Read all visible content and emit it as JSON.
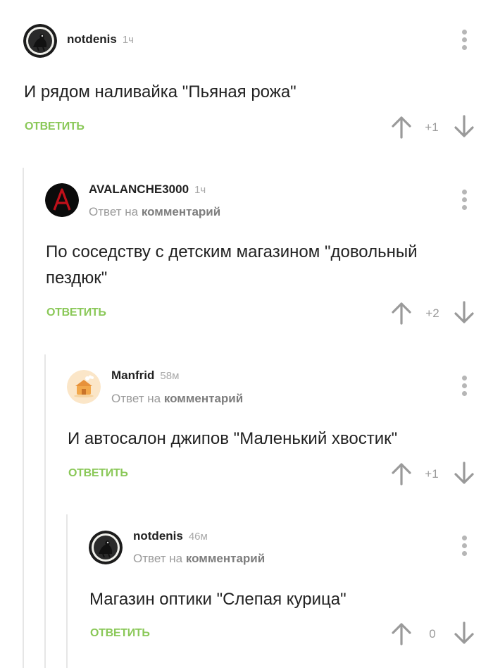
{
  "thread": {
    "comments": [
      {
        "username": "notdenis",
        "time": "1ч",
        "text": "И рядом наливайка \"Пьяная рожа\"",
        "reply_label": "ОТВЕТИТЬ",
        "rating": "+1"
      },
      {
        "username": "AVALANCHE3000",
        "time": "1ч",
        "reply_prefix": "Ответ на",
        "reply_target": "комментарий",
        "text": "По соседству с детским магазином \"довольный пездюк\"",
        "reply_label": "ОТВЕТИТЬ",
        "rating": "+2"
      },
      {
        "username": "Manfrid",
        "time": "58м",
        "reply_prefix": "Ответ на",
        "reply_target": "комментарий",
        "text": "И автосалон джипов \"Маленький хвостик\"",
        "reply_label": "ОТВЕТИТЬ",
        "rating": "+1"
      },
      {
        "username": "notdenis",
        "time": "46м",
        "reply_prefix": "Ответ на",
        "reply_target": "комментарий",
        "text": "Магазин оптики \"Слепая курица\"",
        "reply_label": "ОТВЕТИТЬ",
        "rating": "0"
      }
    ]
  },
  "colors": {
    "accent_green": "#8ac858",
    "muted_text": "#9a9a9a",
    "icon_gray": "#9a9a9a"
  }
}
